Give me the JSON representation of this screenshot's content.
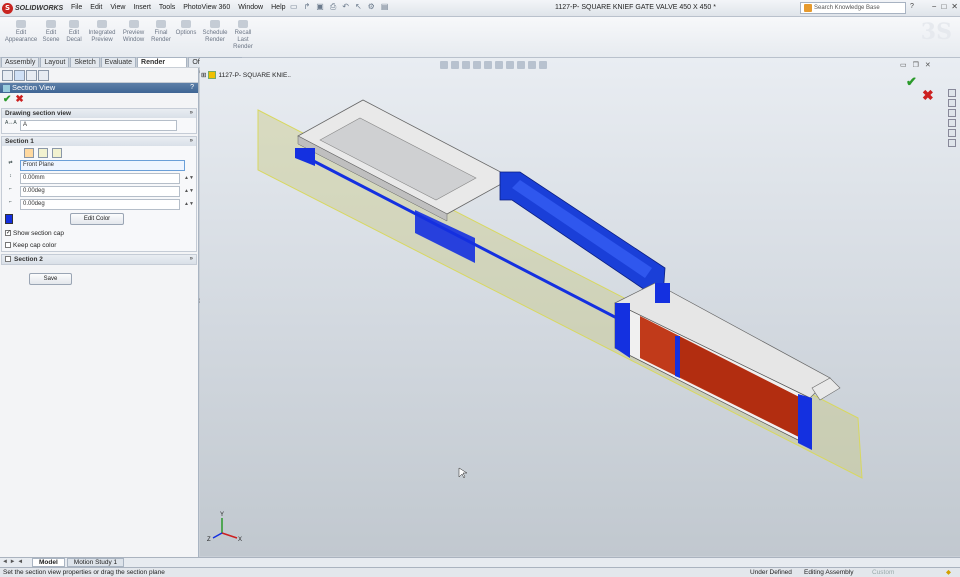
{
  "app": {
    "logo_text": "SOLIDWORKS",
    "menu": [
      "File",
      "Edit",
      "View",
      "Insert",
      "Tools",
      "PhotoView 360",
      "Window",
      "Help"
    ],
    "document_title": "1127-P- SQUARE KNIEF GATE VALVE 450 X 450 *",
    "search_placeholder": "Search Knowledge Base"
  },
  "ribbon": {
    "buttons": [
      {
        "label": "Edit Appearance",
        "icon": "edit-appearance-icon"
      },
      {
        "label": "Edit Scene",
        "icon": "edit-scene-icon"
      },
      {
        "label": "Edit Decal",
        "icon": "edit-decal-icon"
      },
      {
        "label": "Integrated Preview",
        "icon": "integrated-preview-icon"
      },
      {
        "label": "Preview Window",
        "icon": "preview-window-icon"
      },
      {
        "label": "Final Render",
        "icon": "final-render-icon"
      },
      {
        "label": "Options",
        "icon": "options-icon"
      },
      {
        "label": "Schedule Render",
        "icon": "schedule-render-icon"
      },
      {
        "label": "Recall Last Render",
        "icon": "recall-render-icon"
      }
    ]
  },
  "tabs": [
    "Assembly",
    "Layout",
    "Sketch",
    "Evaluate",
    "Render Tools",
    "Office Products"
  ],
  "active_tab": "Render Tools",
  "property_manager": {
    "title": "Section View",
    "help": "?",
    "drawing_section": {
      "header": "Drawing section view",
      "name_value": "A"
    },
    "section1": {
      "header": "Section 1",
      "plane_value": "Front Plane",
      "offset_value": "0.00mm",
      "angle_x_value": "0.00deg",
      "angle_y_value": "0.00deg",
      "edit_color_label": "Edit Color",
      "cap_color": "#1430e0",
      "show_cap_label": "Show section cap",
      "show_cap_checked": true,
      "keep_cap_label": "Keep cap color",
      "keep_cap_checked": false
    },
    "section2": {
      "header": "Section 2"
    },
    "save_label": "Save"
  },
  "viewport": {
    "tree_label": "1127-P- SQUARE KNIE..",
    "triad_labels": {
      "x": "X",
      "y": "Y",
      "z": "Z"
    }
  },
  "bottom_tabs": [
    "Model",
    "Motion Study 1"
  ],
  "active_bottom_tab": "Model",
  "status": {
    "message": "Set the section view properties or drag the section plane",
    "state1": "Under Defined",
    "state2": "Editing Assembly",
    "state3": "Custom"
  },
  "colors": {
    "section_cap": "#1430e0",
    "cylinder": "#c13a1a",
    "plane": "#c9c98a"
  }
}
